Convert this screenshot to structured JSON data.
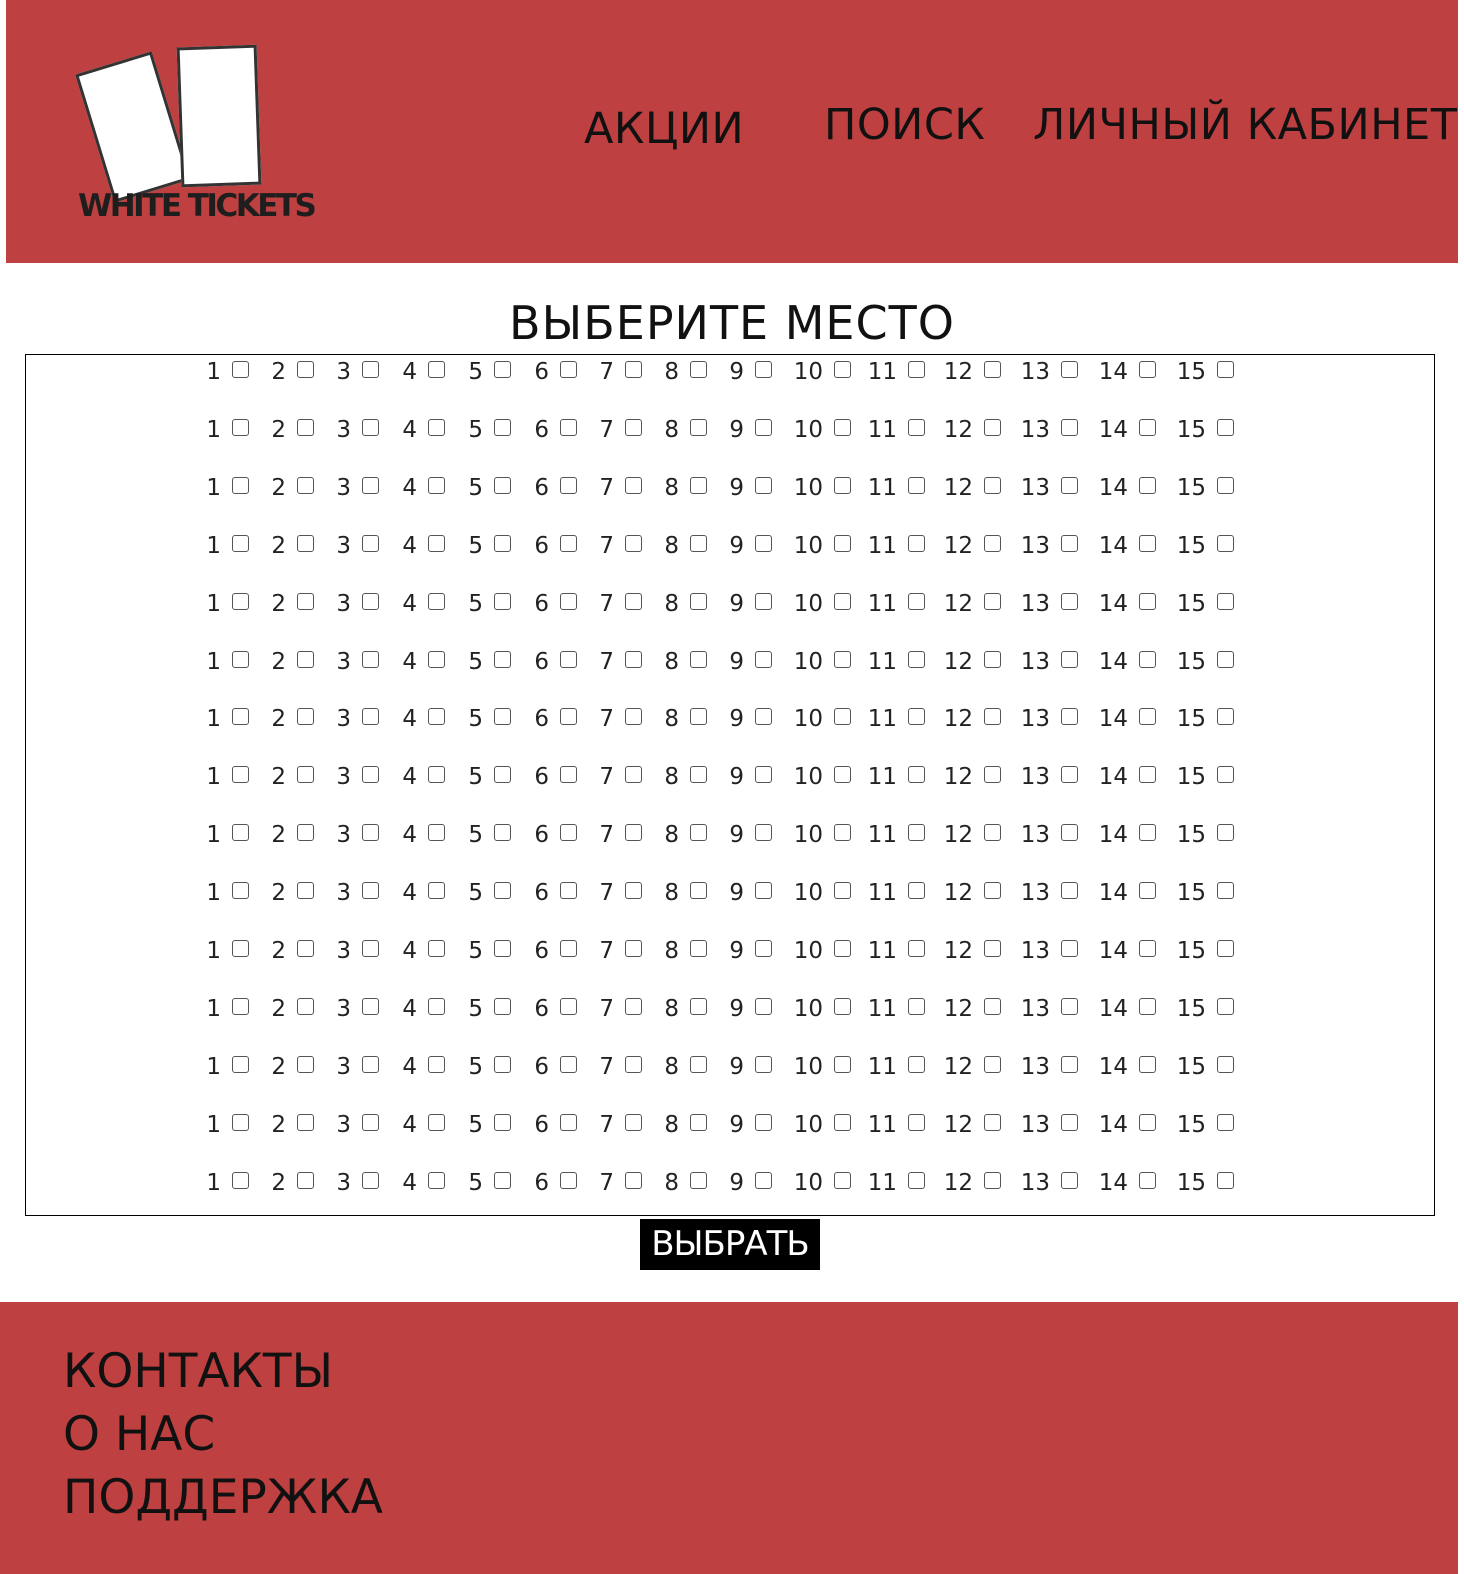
{
  "header": {
    "logo_text": "WHITE TICKETS",
    "nav": {
      "actions": "АКЦИИ",
      "search": "ПОИСК",
      "account": "ЛИЧНЫЙ КАБИНЕТ"
    }
  },
  "page": {
    "title": "ВЫБЕРИТЕ МЕСТО"
  },
  "seats": {
    "row_count": 15,
    "seat_labels": [
      "1",
      "2",
      "3",
      "4",
      "5",
      "6",
      "7",
      "8",
      "9",
      "10",
      "11",
      "12",
      "13",
      "14",
      "15"
    ]
  },
  "actions": {
    "select_label": "ВЫБРАТЬ"
  },
  "footer": {
    "contacts": "КОНТАКТЫ",
    "about": "О НАС",
    "support": "ПОДДЕРЖКА"
  },
  "colors": {
    "brand_red": "#bf4040",
    "button_bg": "#000000"
  }
}
